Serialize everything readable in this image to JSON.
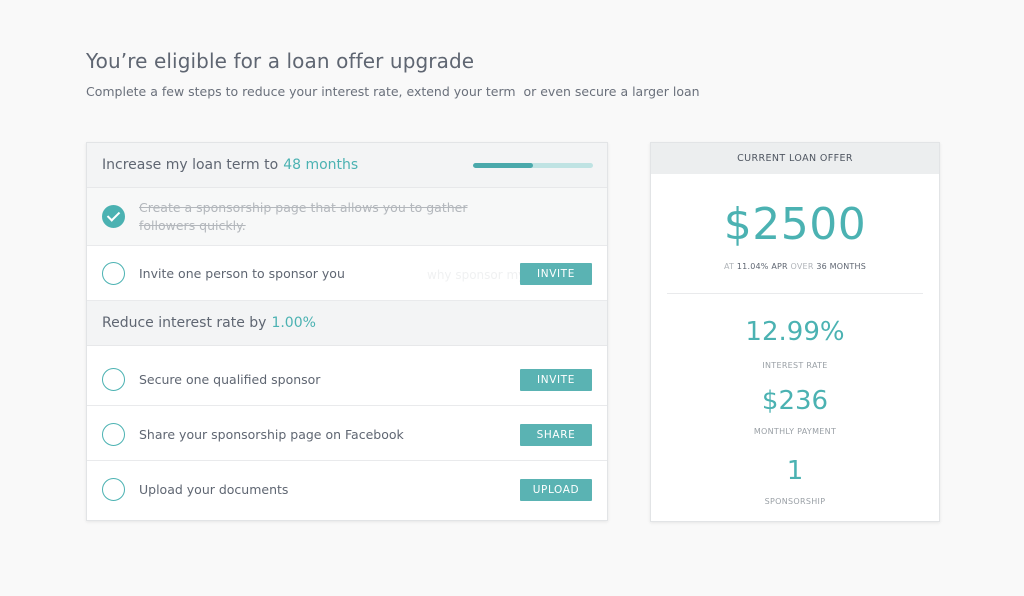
{
  "header": {
    "title": "You’re eligible for a loan offer upgrade",
    "subtitle": "Complete a few steps to reduce your interest rate, extend your term  or even secure a larger loan"
  },
  "sections": [
    {
      "prefix": "Increase my loan term to",
      "highlight": "48 months",
      "progress": 0.5,
      "steps": [
        {
          "label": "Create a sponsorship page that allows you to gather followers quickly.",
          "done": true
        },
        {
          "label": "Invite one person to sponsor you",
          "ghost_text": "why sponsor my loan",
          "done": false,
          "action": "INVITE"
        }
      ]
    },
    {
      "prefix": "Reduce interest rate by",
      "highlight": "1.00%",
      "steps": [
        {
          "label": "Secure one qualified sponsor",
          "done": false,
          "action": "INVITE"
        },
        {
          "label": "Share your sponsorship page on Facebook",
          "done": false,
          "action": "SHARE"
        },
        {
          "label": "Upload your documents",
          "done": false,
          "action": "UPLOAD"
        }
      ]
    }
  ],
  "offer": {
    "header": "CURRENT LOAN OFFER",
    "amount": "$2500",
    "at_word": "AT",
    "apr": "11.04% APR",
    "over_word": "OVER",
    "term": "36 MONTHS",
    "stats": [
      {
        "value": "12.99%",
        "label": "INTEREST RATE"
      },
      {
        "value": "$236",
        "label": "MONTHLY PAYMENT"
      },
      {
        "value": "1",
        "label": "SPONSORSHIP"
      }
    ]
  },
  "colors": {
    "accent": "#4bb2b2",
    "button": "#5ab3b3",
    "text": "#5f6672",
    "background": "#f9f9f9"
  },
  "icons": {
    "check": "check-circle-icon",
    "todo": "empty-circle-icon"
  }
}
